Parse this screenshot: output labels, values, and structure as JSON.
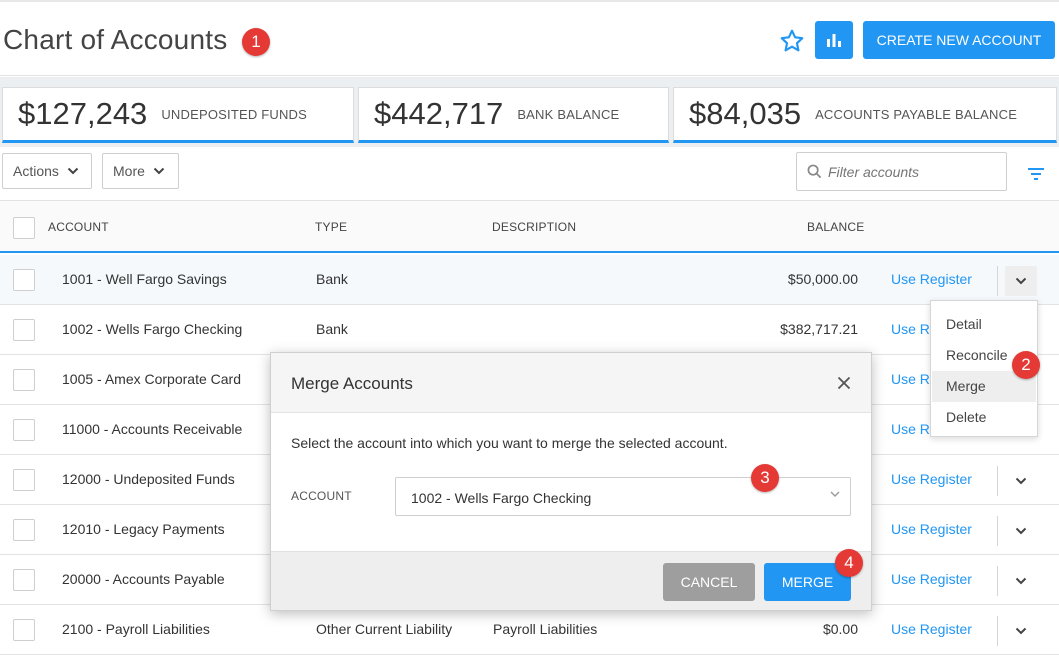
{
  "header": {
    "title": "Chart of Accounts",
    "create_button": "CREATE NEW ACCOUNT",
    "accent": "#2196f3"
  },
  "markers": [
    "1",
    "2",
    "3",
    "4"
  ],
  "summary": [
    {
      "amount": "$127,243",
      "label": "UNDEPOSITED FUNDS"
    },
    {
      "amount": "$442,717",
      "label": "BANK BALANCE"
    },
    {
      "amount": "$84,035",
      "label": "ACCOUNTS PAYABLE BALANCE"
    }
  ],
  "toolbar": {
    "actions_label": "Actions",
    "more_label": "More",
    "filter_placeholder": "Filter accounts"
  },
  "table": {
    "columns": {
      "account": "ACCOUNT",
      "type": "TYPE",
      "description": "DESCRIPTION",
      "balance": "BALANCE"
    },
    "action_label": "Use Register",
    "rows": [
      {
        "account": "1001 - Well Fargo Savings",
        "type": "Bank",
        "description": "",
        "balance": "$50,000.00",
        "action": "Use Register"
      },
      {
        "account": "1002 - Wells Fargo Checking",
        "type": "Bank",
        "description": "",
        "balance": "$382,717.21",
        "action": "Use Re"
      },
      {
        "account": "1005 - Amex Corporate Card",
        "type": "",
        "description": "",
        "balance": "",
        "action": "Use Re"
      },
      {
        "account": "11000 - Accounts Receivable",
        "type": "",
        "description": "",
        "balance": "",
        "action": "Use Re"
      },
      {
        "account": "12000 - Undeposited Funds",
        "type": "",
        "description": "",
        "balance": "",
        "action": "Use Register"
      },
      {
        "account": "12010 - Legacy Payments",
        "type": "",
        "description": "",
        "balance": "",
        "action": "Use Register"
      },
      {
        "account": "20000 - Accounts Payable",
        "type": "",
        "description": "",
        "balance": "",
        "action": "Use Register"
      },
      {
        "account": "2100 - Payroll Liabilities",
        "type": "Other Current Liability",
        "description": "Payroll Liabilities",
        "balance": "$0.00",
        "action": "Use Register"
      }
    ]
  },
  "context_menu": {
    "items": [
      "Detail",
      "Reconcile",
      "Merge",
      "Delete"
    ]
  },
  "modal": {
    "title": "Merge Accounts",
    "message": "Select the account into which you want to merge the selected account.",
    "account_label": "ACCOUNT",
    "selected_account": "1002 - Wells Fargo Checking",
    "cancel_label": "CANCEL",
    "merge_label": "MERGE"
  }
}
